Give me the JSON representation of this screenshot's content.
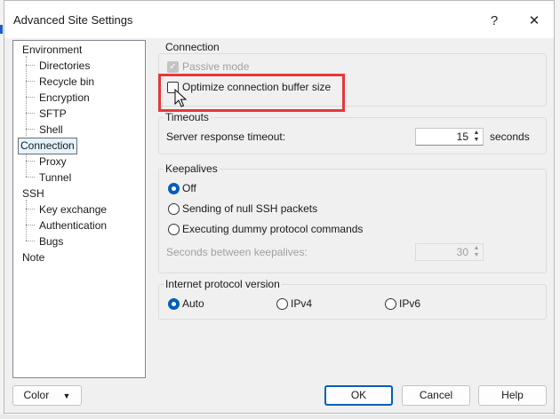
{
  "window": {
    "title": "Advanced Site Settings",
    "help_glyph": "?",
    "close_glyph": "✕"
  },
  "tree": {
    "items": [
      {
        "label": "Environment",
        "level": 0,
        "selected": false
      },
      {
        "label": "Directories",
        "level": 1,
        "selected": false
      },
      {
        "label": "Recycle bin",
        "level": 1,
        "selected": false
      },
      {
        "label": "Encryption",
        "level": 1,
        "selected": false
      },
      {
        "label": "SFTP",
        "level": 1,
        "selected": false
      },
      {
        "label": "Shell",
        "level": 1,
        "selected": false
      },
      {
        "label": "Connection",
        "level": 0,
        "selected": true
      },
      {
        "label": "Proxy",
        "level": 1,
        "selected": false
      },
      {
        "label": "Tunnel",
        "level": 1,
        "selected": false
      },
      {
        "label": "SSH",
        "level": 0,
        "selected": false
      },
      {
        "label": "Key exchange",
        "level": 1,
        "selected": false
      },
      {
        "label": "Authentication",
        "level": 1,
        "selected": false
      },
      {
        "label": "Bugs",
        "level": 1,
        "selected": false
      },
      {
        "label": "Note",
        "level": 0,
        "selected": false
      }
    ]
  },
  "connection": {
    "title": "Connection",
    "passive_mode": {
      "label": "Passive mode",
      "checked": true,
      "enabled": false
    },
    "optimize_buffer": {
      "label": "Optimize connection buffer size",
      "checked": false,
      "enabled": true
    }
  },
  "timeouts": {
    "title": "Timeouts",
    "server_response_label": "Server response timeout:",
    "value": "15",
    "unit": "seconds"
  },
  "keepalives": {
    "title": "Keepalives",
    "options": [
      {
        "label": "Off",
        "selected": true
      },
      {
        "label": "Sending of null SSH packets",
        "selected": false
      },
      {
        "label": "Executing dummy protocol commands",
        "selected": false
      }
    ],
    "seconds_label": "Seconds between keepalives:",
    "seconds_value": "30"
  },
  "ip_version": {
    "title": "Internet protocol version",
    "options": [
      {
        "label": "Auto",
        "selected": true
      },
      {
        "label": "IPv4",
        "selected": false
      },
      {
        "label": "IPv6",
        "selected": false
      }
    ]
  },
  "buttons": {
    "color": "Color",
    "color_arrow": "▼",
    "ok": "OK",
    "cancel": "Cancel",
    "help": "Help"
  },
  "colors": {
    "accent": "#005fb8",
    "highlight_box": "#e5383c"
  },
  "spin_up_glyph": "▲",
  "spin_down_glyph": "▼",
  "check_glyph": "✓"
}
